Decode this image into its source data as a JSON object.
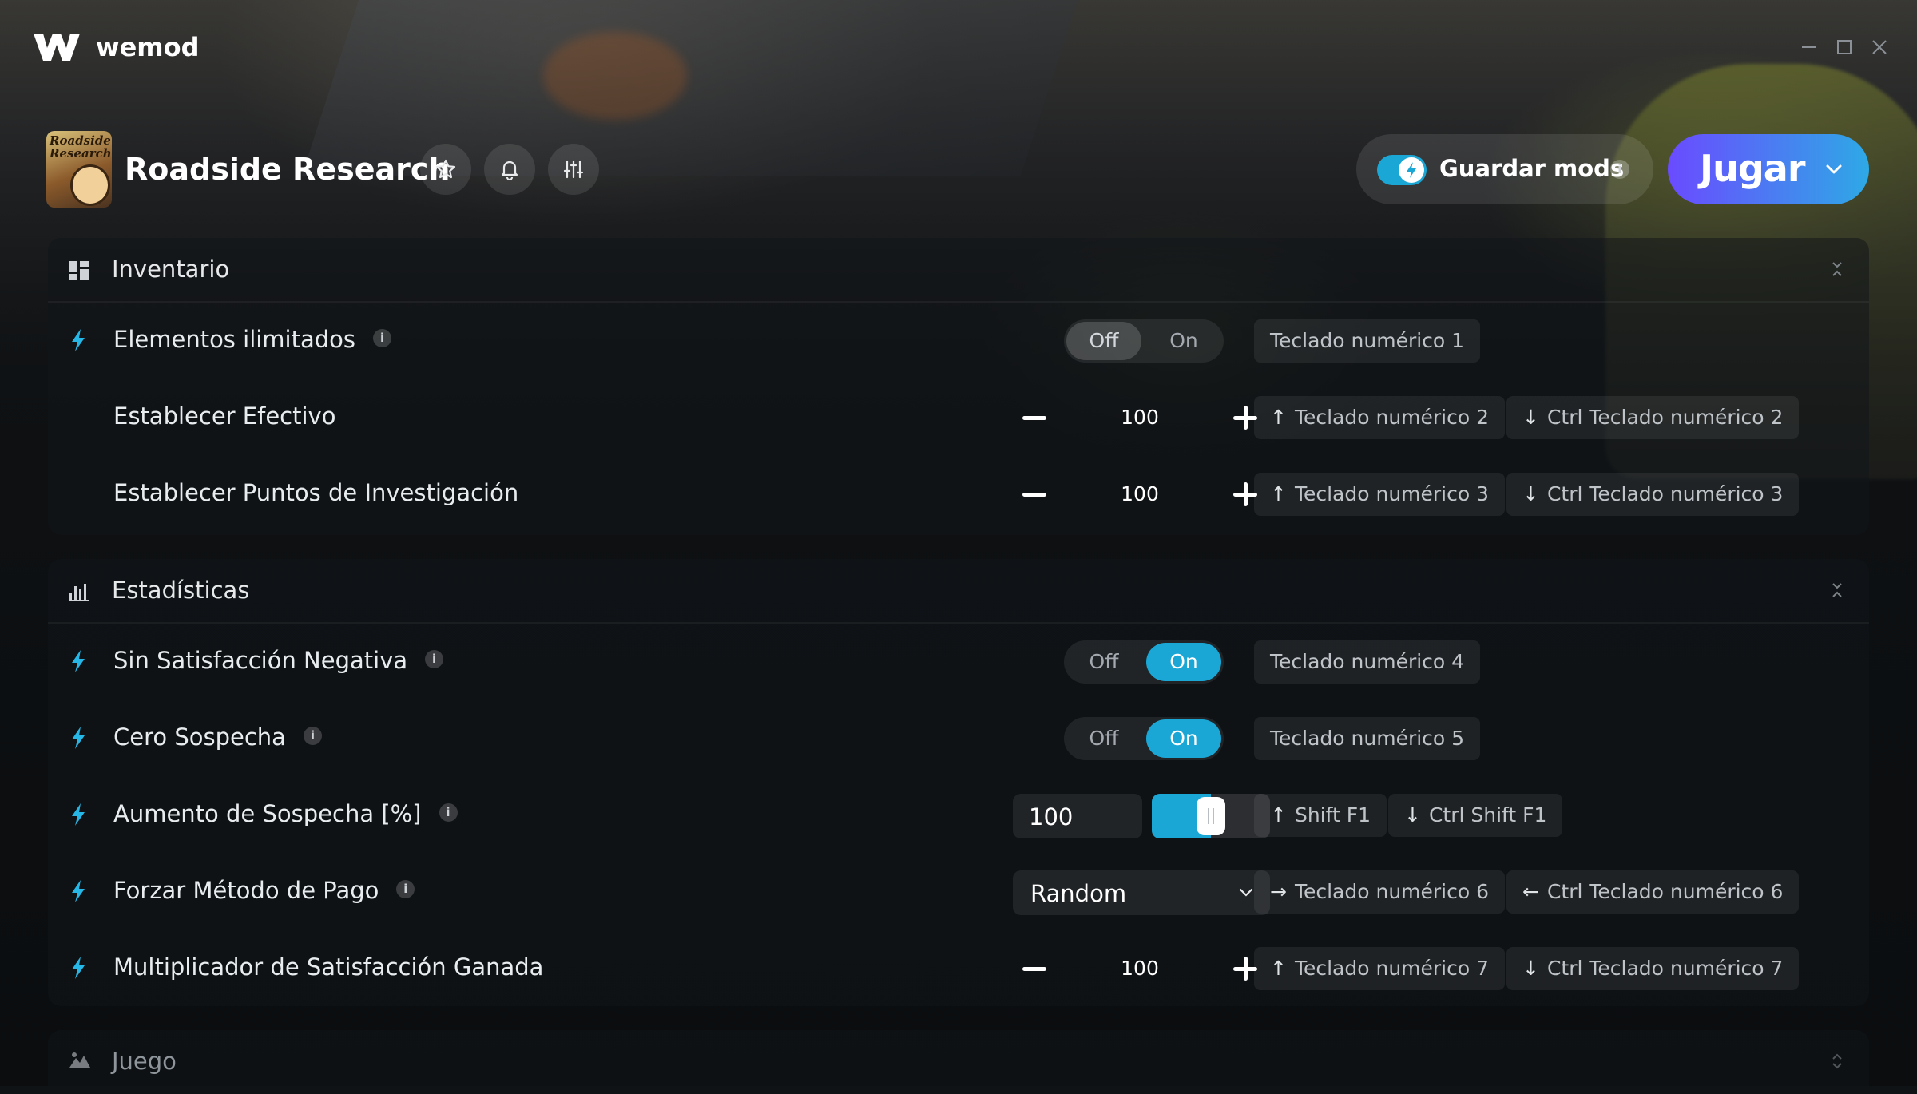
{
  "app": {
    "brand": "wemod",
    "minimize_icon": "minimize-icon",
    "maximize_icon": "maximize-icon",
    "close_icon": "close-icon"
  },
  "game": {
    "title": "Roadside Research",
    "thumb_text_1": "Roadside",
    "thumb_text_2": "Research",
    "favorite_icon": "star-icon",
    "notify_icon": "bell-icon",
    "settings_icon": "sliders-icon"
  },
  "save_mods": {
    "label": "Guardar mods",
    "info": "i",
    "enabled": true
  },
  "play": {
    "label": "Jugar"
  },
  "sections": {
    "inventario": {
      "title": "Inventario",
      "rows": {
        "elementos": {
          "label": "Elementos ilimitados",
          "info": "i",
          "off": "Off",
          "on": "On",
          "state": "off",
          "hotkey": "Teclado numérico 1"
        },
        "efectivo": {
          "label": "Establecer Efectivo",
          "value": "100",
          "hotkey_up": "Teclado numérico 2",
          "hotkey_down": "Ctrl Teclado numérico 2"
        },
        "puntos": {
          "label": "Establecer Puntos de Investigación",
          "value": "100",
          "hotkey_up": "Teclado numérico 3",
          "hotkey_down": "Ctrl Teclado numérico 3"
        }
      }
    },
    "estadisticas": {
      "title": "Estadísticas",
      "rows": {
        "sin_satisfaccion": {
          "label": "Sin Satisfacción Negativa",
          "info": "i",
          "off": "Off",
          "on": "On",
          "state": "on",
          "hotkey": "Teclado numérico 4"
        },
        "cero_sospecha": {
          "label": "Cero Sospecha",
          "info": "i",
          "off": "Off",
          "on": "On",
          "state": "on",
          "hotkey": "Teclado numérico 5"
        },
        "aumento_sospecha": {
          "label": "Aumento de Sospecha [%]",
          "info": "i",
          "value": "100",
          "slider_fraction": 0.5,
          "hotkey_up": "Shift F1",
          "hotkey_down": "Ctrl Shift F1"
        },
        "metodo_pago": {
          "label": "Forzar Método de Pago",
          "info": "i",
          "selected": "Random",
          "hotkey_next": "Teclado numérico 6",
          "hotkey_prev": "Ctrl Teclado numérico 6"
        },
        "multiplicador": {
          "label": "Multiplicador de Satisfacción Ganada",
          "value": "100",
          "hotkey_up": "Teclado numérico 7",
          "hotkey_down": "Ctrl Teclado numérico 7"
        }
      }
    },
    "juego": {
      "title": "Juego"
    }
  },
  "colors": {
    "accent": "#1aa7d6",
    "play_start": "#6a4bff",
    "play_end": "#2ea9e6"
  }
}
